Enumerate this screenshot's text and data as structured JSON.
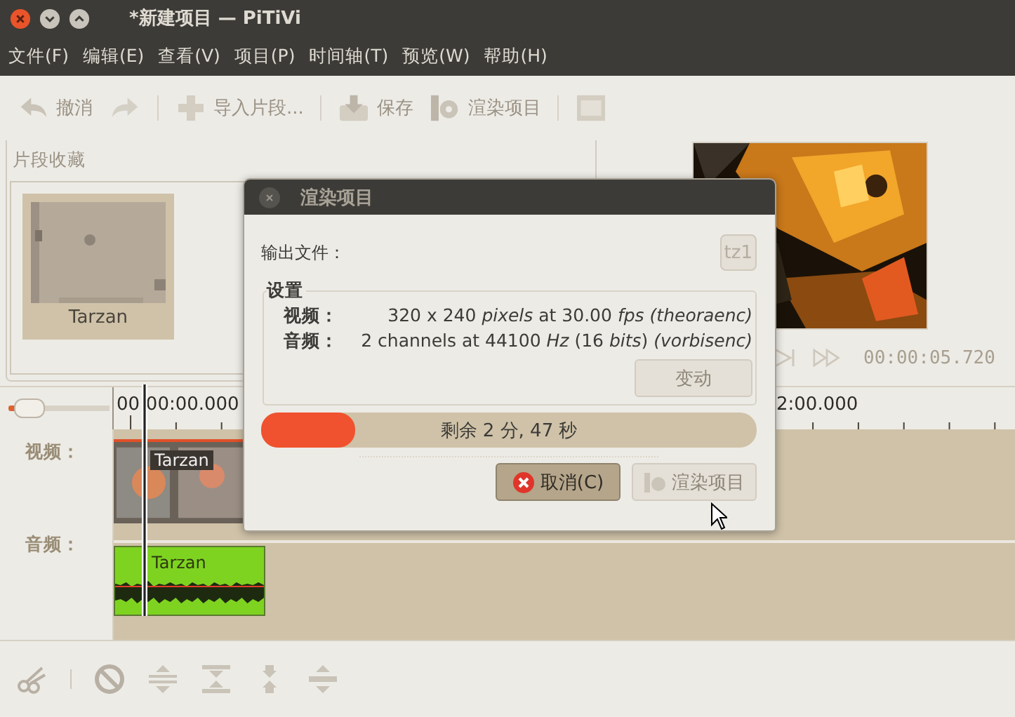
{
  "window": {
    "title": "*新建项目 — PiTiVi"
  },
  "menu": [
    "文件(F)",
    "编辑(E)",
    "查看(V)",
    "项目(P)",
    "时间轴(T)",
    "预览(W)",
    "帮助(H)"
  ],
  "toolbar": [
    [
      {
        "kind": "labeled",
        "label": "撤消"
      },
      {
        "kind": "icon_only"
      }
    ],
    [
      {
        "kind": "labeled",
        "label": "导入片段..."
      }
    ],
    [
      {
        "kind": "labeled",
        "label": "保存"
      },
      {
        "kind": "labeled",
        "label": "渲染项目"
      }
    ],
    [
      {
        "kind": "icon_only"
      }
    ]
  ],
  "clip_library": {
    "title": "片段收藏",
    "clips": [
      {
        "name": "Tarzan"
      }
    ]
  },
  "viewer": {
    "timecode": "00:00:05.720"
  },
  "timeline": {
    "zoom": {
      "level": 0.12
    },
    "ruler_labels": [
      "00:00:00.000",
      "2:00.000"
    ],
    "tracks": [
      {
        "kind": "video",
        "label": "视频：",
        "clips": [
          {
            "name": "Tarzan"
          }
        ]
      },
      {
        "kind": "audio",
        "label": "音频：",
        "clips": [
          {
            "name": "Tarzan"
          }
        ]
      }
    ]
  },
  "dialog": {
    "title": "渲染项目",
    "output_label": "输出文件：",
    "output_button": "tz1",
    "settings": {
      "title": "设置",
      "rows": [
        {
          "label": "视频：",
          "value": "320 x 240 *pixels* at 30.00 *fps* *(theoraenc)*"
        },
        {
          "label": "音频：",
          "value": "2 channels at 44100 *Hz* (16 *bits*) *(vorbisenc)*"
        }
      ],
      "change_button": {
        "label": "变动",
        "disabled": true
      }
    },
    "progress": {
      "level": 0.19,
      "text": "剩余 2 分, 47 秒"
    },
    "buttons": [
      {
        "label": "取消(C)",
        "disabled": false
      },
      {
        "label": "渲染项目",
        "disabled": true
      }
    ]
  }
}
